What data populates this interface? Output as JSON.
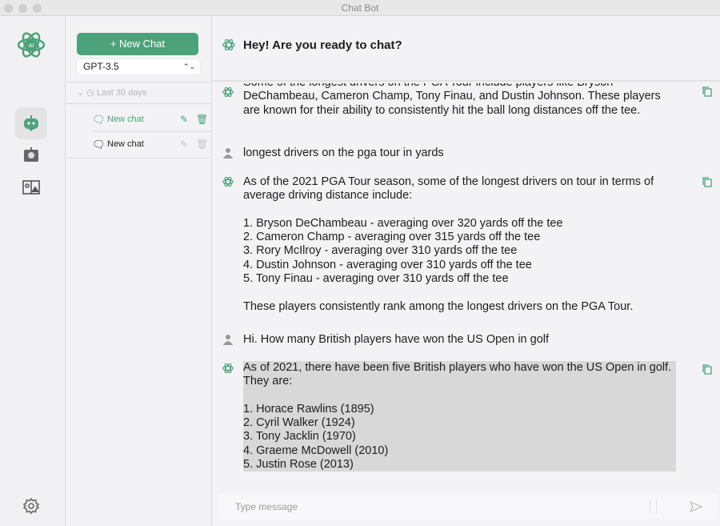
{
  "window": {
    "title": "Chat Bot"
  },
  "sidebar": {
    "new_chat_label": "+ New Chat",
    "model": "GPT-3.5",
    "group_label": "Last 30 days",
    "chats": [
      {
        "label": "New chat",
        "active": true
      },
      {
        "label": "New chat",
        "active": false
      }
    ]
  },
  "header": {
    "title": "Hey! Are you ready to chat?"
  },
  "messages": [
    {
      "role": "assistant",
      "text": "Some of the longest drivers on the PGA Tour include players like Bryson DeChambeau, Cameron Champ, Tony Finau, and Dustin Johnson. These players are known for their ability to consistently hit the ball long distances off the tee."
    },
    {
      "role": "user",
      "text": "longest drivers on the pga tour in yards"
    },
    {
      "role": "assistant",
      "text": "As of the 2021 PGA Tour season, some of the longest drivers on tour in terms of average driving distance include:\n\n1. Bryson DeChambeau - averaging over 320 yards off the tee\n2. Cameron Champ - averaging over 315 yards off the tee\n3. Rory McIlroy - averaging over 310 yards off the tee\n4. Dustin Johnson - averaging over 310 yards off the tee\n5. Tony Finau - averaging over 310 yards off the tee\n\nThese players consistently rank among the longest drivers on the PGA Tour."
    },
    {
      "role": "user",
      "text": "Hi. How many British players have won the US Open in golf"
    },
    {
      "role": "assistant",
      "text": "As of 2021, there have been five British players who have won the US Open in golf. They are:\n\n1. Horace Rawlins (1895)\n2. Cyril Walker (1924)\n3. Tony Jacklin (1970)\n4. Graeme McDowell (2010)\n5. Justin Rose (2013)"
    }
  ],
  "composer": {
    "placeholder": "Type message"
  },
  "colors": {
    "accent": "#4ea27b"
  }
}
